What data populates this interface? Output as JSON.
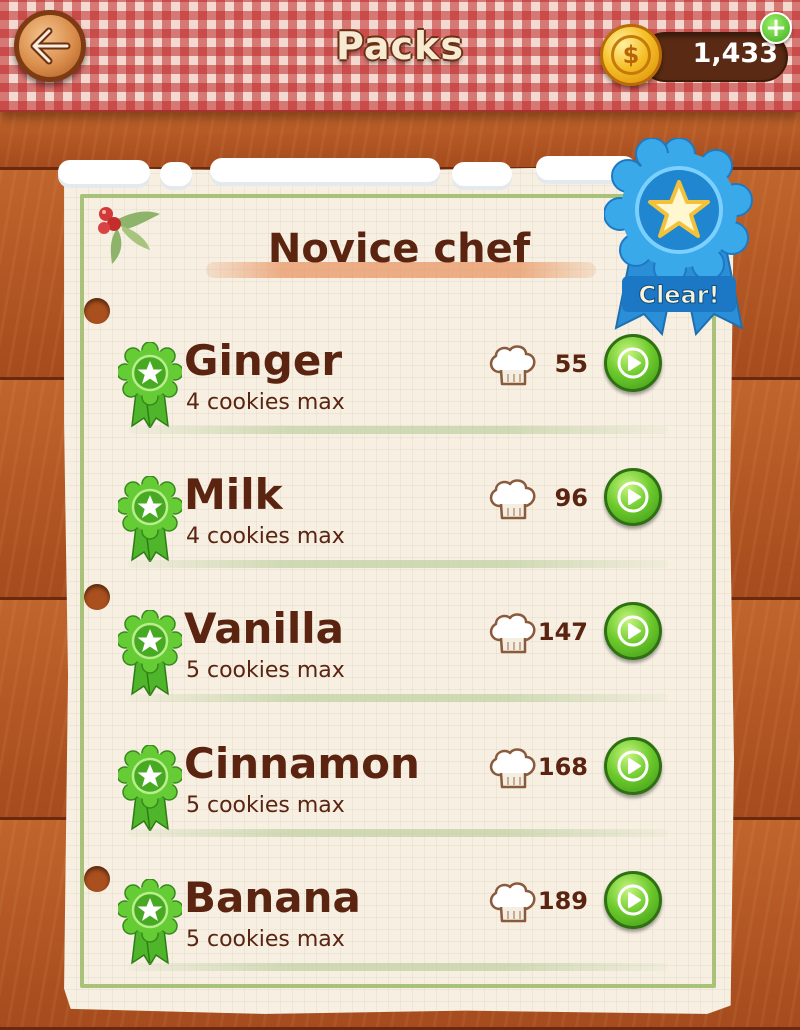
{
  "header": {
    "title": "Packs",
    "coins": "1,433",
    "coin_symbol": "$",
    "plus_symbol": "+"
  },
  "pack": {
    "title": "Novice chef",
    "status_badge": "Clear!"
  },
  "levels": [
    {
      "name": "Ginger",
      "subtitle": "4 cookies max",
      "score": "55"
    },
    {
      "name": "Milk",
      "subtitle": "4 cookies max",
      "score": "96"
    },
    {
      "name": "Vanilla",
      "subtitle": "5 cookies max",
      "score": "147"
    },
    {
      "name": "Cinnamon",
      "subtitle": "5 cookies max",
      "score": "168"
    },
    {
      "name": "Banana",
      "subtitle": "5 cookies max",
      "score": "189"
    }
  ],
  "colors": {
    "accent_green": "#6ac82a",
    "text_brown": "#5a2410",
    "ribbon_blue": "#2f9ee0",
    "tablecloth_red": "#be2828"
  },
  "icons": {
    "back": "back-arrow-icon",
    "coin": "gold-coin-icon",
    "add": "plus-icon",
    "level_badge": "green-star-rosette-icon",
    "score": "chef-hat-icon",
    "play": "play-icon",
    "pack_badge": "blue-star-rosette-icon"
  }
}
